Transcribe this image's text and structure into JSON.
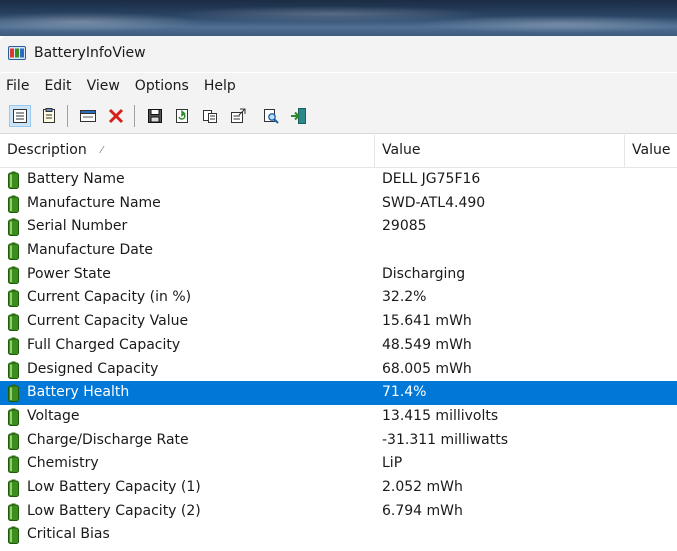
{
  "window": {
    "title": "BatteryInfoView"
  },
  "menu": {
    "file": "File",
    "edit": "Edit",
    "view": "View",
    "options": "Options",
    "help": "Help"
  },
  "toolbar": {
    "buttons": [
      "properties-list-icon",
      "html-report-icon",
      "computer-icon",
      "delete-icon",
      "save-icon",
      "refresh-icon",
      "copy-icon",
      "properties-icon",
      "find-icon",
      "exit-icon"
    ]
  },
  "columns": {
    "description": "Description",
    "value": "Value",
    "value2": "Value"
  },
  "rows": [
    {
      "description": "Battery Name",
      "value": "DELL JG75F16"
    },
    {
      "description": "Manufacture Name",
      "value": "SWD-ATL4.490"
    },
    {
      "description": "Serial Number",
      "value": "29085"
    },
    {
      "description": "Manufacture Date",
      "value": ""
    },
    {
      "description": "Power State",
      "value": "Discharging"
    },
    {
      "description": "Current Capacity (in %)",
      "value": "32.2%"
    },
    {
      "description": "Current Capacity Value",
      "value": "15.641 mWh"
    },
    {
      "description": "Full Charged Capacity",
      "value": "48.549 mWh"
    },
    {
      "description": "Designed Capacity",
      "value": "68.005 mWh"
    },
    {
      "description": "Battery Health",
      "value": "71.4%",
      "selected": true
    },
    {
      "description": "Voltage",
      "value": "13.415 millivolts"
    },
    {
      "description": "Charge/Discharge Rate",
      "value": "-31.311 milliwatts"
    },
    {
      "description": "Chemistry",
      "value": "LiP"
    },
    {
      "description": "Low Battery Capacity (1)",
      "value": "2.052 mWh"
    },
    {
      "description": "Low Battery Capacity (2)",
      "value": "6.794 mWh"
    },
    {
      "description": "Critical Bias",
      "value": ""
    }
  ],
  "colors": {
    "selection": "#0078d7",
    "battery_icon": "#3c8c1e",
    "chrome": "#f3f3f3"
  }
}
